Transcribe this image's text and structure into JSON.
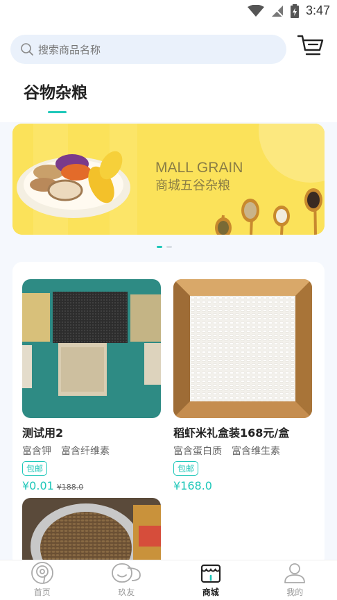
{
  "status_bar": {
    "time": "3:47"
  },
  "search": {
    "placeholder": "搜索商品名称"
  },
  "category": {
    "title": "谷物杂粮"
  },
  "banner": {
    "title_en": "MALL GRAIN",
    "title_cn": "商城五谷杂粮"
  },
  "products": [
    {
      "name": "测试用2",
      "tags": [
        "富含钾",
        "富含纤维素"
      ],
      "badge": "包邮",
      "price": "¥0.01",
      "old_price": "¥188.0"
    },
    {
      "name": "稻虾米礼盒装168元/盒",
      "tags": [
        "富含蛋白质",
        "富含维生素"
      ],
      "badge": "包邮",
      "price": "¥168.0",
      "old_price": ""
    }
  ],
  "nav": [
    {
      "label": "首页",
      "icon": "home-icon"
    },
    {
      "label": "玖友",
      "icon": "chat-icon"
    },
    {
      "label": "商城",
      "icon": "store-icon"
    },
    {
      "label": "我的",
      "icon": "profile-icon"
    }
  ],
  "colors": {
    "accent": "#1ec7b9",
    "banner_bg": "#fbe25a",
    "search_bg": "#eaf1fb"
  }
}
